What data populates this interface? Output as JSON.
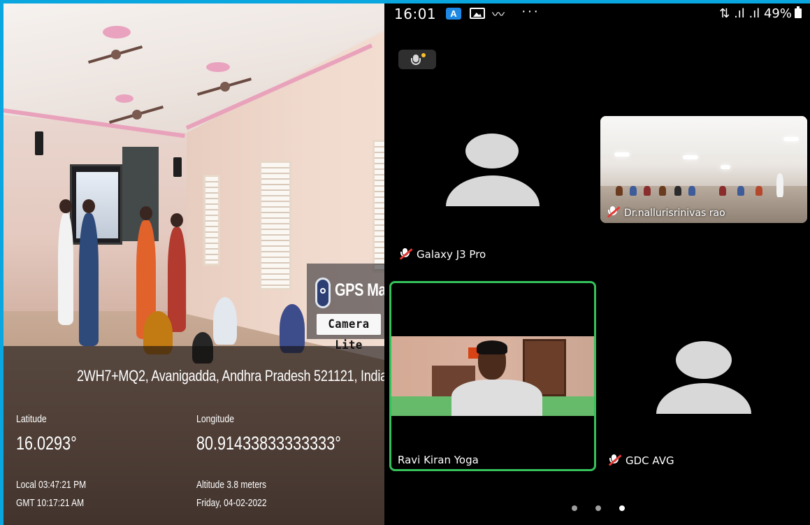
{
  "gps_photo": {
    "logo_title": "GPS Map",
    "logo_subtitle": "Camera Lite",
    "address": "2WH7+MQ2, Avanigadda, Andhra Pradesh 521121, India",
    "latitude_label": "Latitude",
    "latitude_value": "16.0293°",
    "longitude_label": "Longitude",
    "longitude_value": "80.91433833333333°",
    "local_time": "Local 03:47:21 PM",
    "gmt_time": "GMT 10:17:21 AM",
    "altitude": "Altitude 3.8 meters",
    "date": "Friday, 04-02-2022"
  },
  "status_bar": {
    "time": "16:01",
    "app_badge": "A",
    "overflow": "···",
    "signal": "⇅ .ıl .ıl",
    "battery": "49%"
  },
  "call": {
    "participants": [
      {
        "name": "Galaxy J3 Pro",
        "muted": true,
        "video": false
      },
      {
        "name": "Dr.nallurisrinivas rao",
        "muted": true,
        "video": true
      },
      {
        "name": "Ravi Kiran Yoga",
        "muted": false,
        "video": true,
        "active_speaker": true
      },
      {
        "name": "GDC AVG",
        "muted": true,
        "video": false
      }
    ],
    "page_count": 3,
    "current_page": 3
  },
  "colors": {
    "frame": "#0aa6e0",
    "active_border": "#34c15a",
    "mute_slash": "#e53935",
    "avatar": "#d8d8d8"
  },
  "icons": [
    "gps-pin-icon",
    "mic-icon",
    "muted-mic-icon",
    "battery-icon",
    "image-icon",
    "signal-icon"
  ]
}
